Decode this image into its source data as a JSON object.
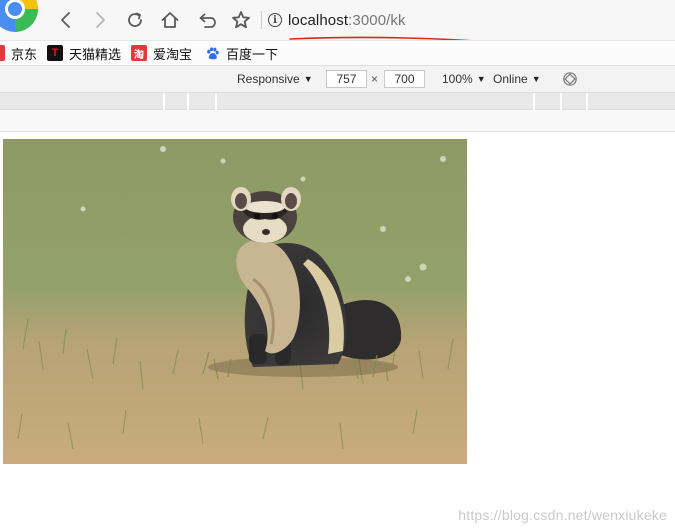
{
  "toolbar": {
    "url_host": "localhost",
    "url_path": ":3000/kk",
    "icons": [
      "back-icon",
      "forward-icon",
      "reload-icon",
      "home-icon",
      "undo-icon",
      "star-icon",
      "info-icon"
    ]
  },
  "bookmarks": [
    {
      "label": "京东",
      "icon": "jd-icon"
    },
    {
      "label": "天猫精选",
      "icon": "tmall-icon",
      "glyph": "T",
      "color": "#d80000"
    },
    {
      "label": "爱淘宝",
      "icon": "taobao-icon",
      "glyph": "淘",
      "color": "#e4393c"
    },
    {
      "label": "百度一下",
      "icon": "baidu-paw-icon",
      "color": "#2f6ff0"
    }
  ],
  "device_toolbar": {
    "mode": "Responsive",
    "width": "757",
    "times": "×",
    "height": "700",
    "zoom": "100%",
    "network": "Online"
  },
  "content": {
    "image_subject": "ferret holding prey in grass field",
    "watermark": "https://blog.csdn.net/wenxiukeke"
  },
  "colors": {
    "annotation_red": "#e0261d",
    "grass": "#8c9a62",
    "soil": "#c7aa7c"
  }
}
